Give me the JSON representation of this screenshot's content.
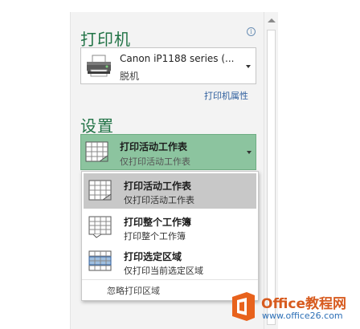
{
  "printer_section": {
    "title": "打印机",
    "info_icon": "i",
    "printer_name": "Canon iP1188 series (...",
    "printer_status": "脱机",
    "properties_link": "打印机属性"
  },
  "settings_section": {
    "title": "设置",
    "selected": {
      "title": "打印活动工作表",
      "subtitle": "仅打印活动工作表"
    },
    "options": [
      {
        "title": "打印活动工作表",
        "subtitle": "仅打印活动工作表"
      },
      {
        "title": "打印整个工作簿",
        "subtitle": "打印整个工作簿"
      },
      {
        "title": "打印选定区域",
        "subtitle": "仅打印当前选定区域"
      }
    ],
    "ignore_print_area": "忽略打印区域"
  },
  "watermark": {
    "brand": "Office教程网",
    "url": "www.office26.com"
  },
  "colors": {
    "accent_green": "#217346",
    "selected_green": "#8cc49f",
    "link_blue": "#2f5f9e",
    "logo_orange": "#d75b1f"
  }
}
